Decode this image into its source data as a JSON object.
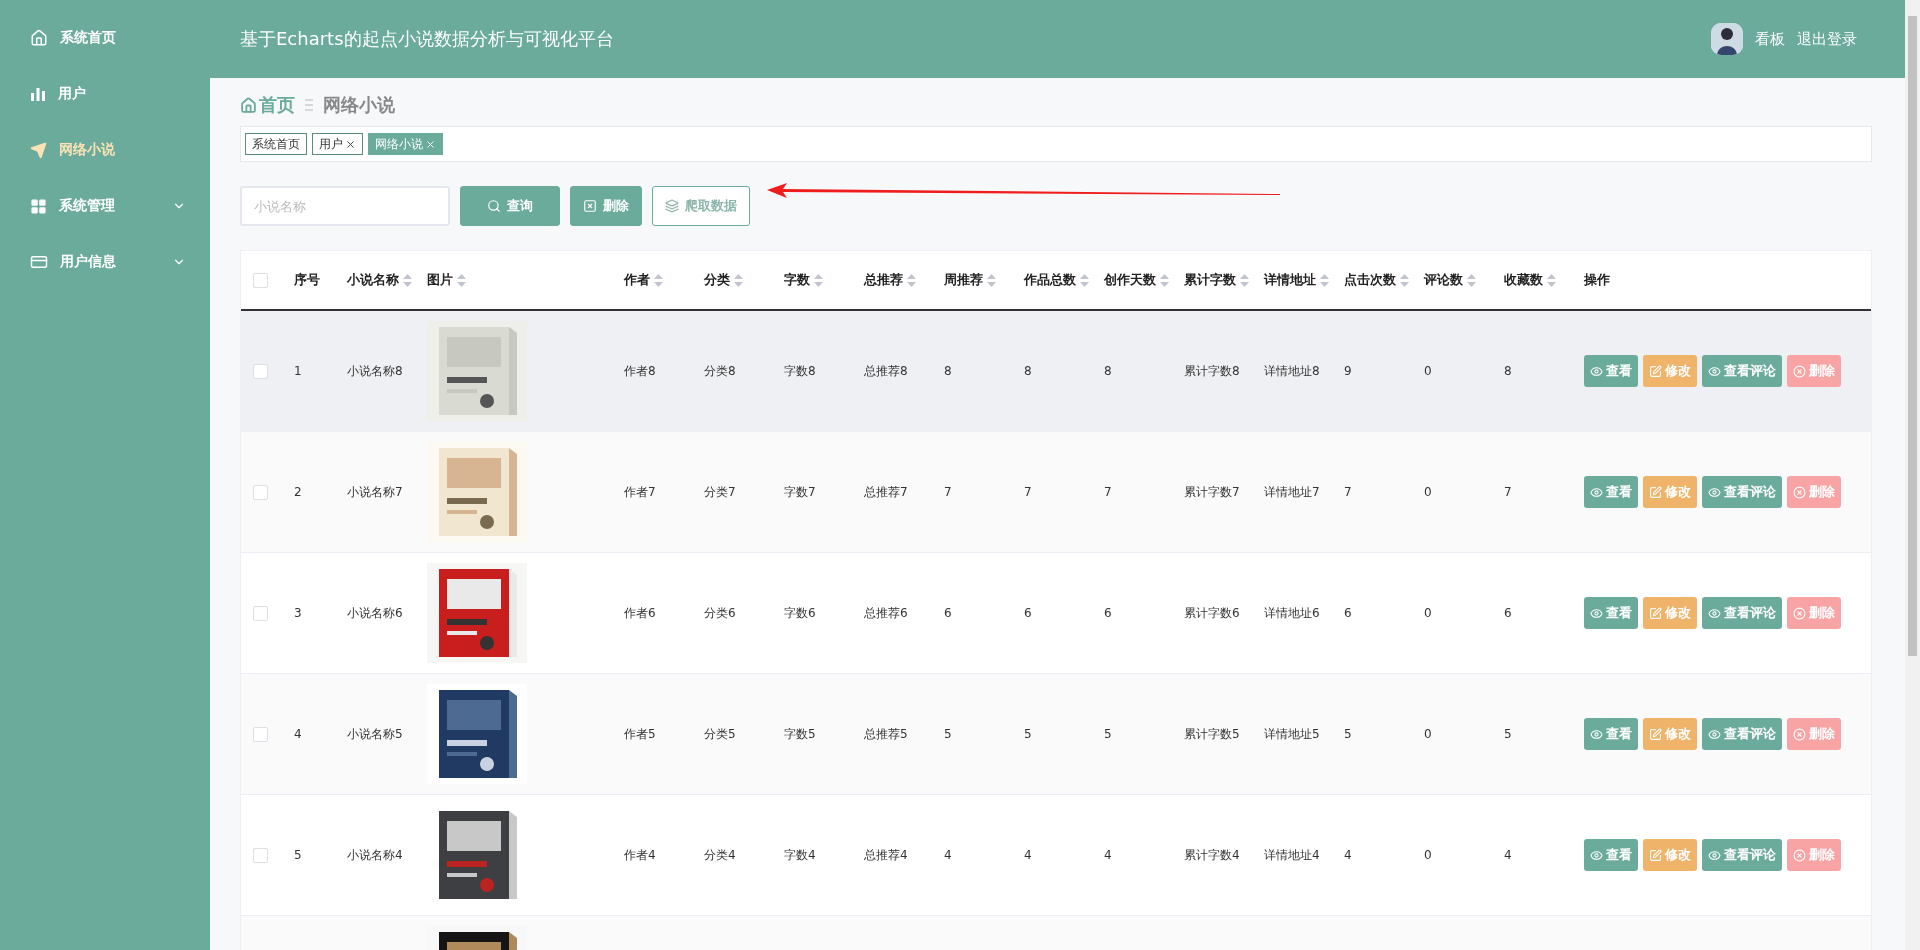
{
  "sidebar": {
    "items": [
      {
        "label": "系统首页",
        "selected": false,
        "has_submenu": false
      },
      {
        "label": "用户",
        "selected": false,
        "has_submenu": false
      },
      {
        "label": "网络小说",
        "selected": true,
        "has_submenu": false
      },
      {
        "label": "系统管理",
        "selected": false,
        "has_submenu": true
      },
      {
        "label": "用户信息",
        "selected": false,
        "has_submenu": true
      }
    ]
  },
  "header": {
    "title": "基于Echarts的起点小说数据分析与可视化平台",
    "user": {
      "name": "看板",
      "logout": "退出登录"
    }
  },
  "breadcrumb": [
    "首页",
    "网络小说"
  ],
  "tabs": [
    {
      "label": "系统首页",
      "closable": false,
      "selected": false
    },
    {
      "label": "用户",
      "closable": true,
      "selected": false
    },
    {
      "label": "网络小说",
      "closable": true,
      "selected": true
    }
  ],
  "toolbar": {
    "search": {
      "placeholder": "小说名称"
    },
    "buttons": [
      {
        "label": "查询",
        "kind": "primary"
      },
      {
        "label": "删除",
        "kind": "primary"
      },
      {
        "label": "爬取数据",
        "kind": "outline"
      }
    ]
  },
  "table": {
    "select_all_checked": false,
    "columns": [
      {
        "label": "序号",
        "sortable": false
      },
      {
        "label": "小说名称",
        "sortable": true
      },
      {
        "label": "图片",
        "sortable": true
      },
      {
        "label": "作者",
        "sortable": true
      },
      {
        "label": "分类",
        "sortable": true
      },
      {
        "label": "字数",
        "sortable": true
      },
      {
        "label": "总推荐",
        "sortable": true
      },
      {
        "label": "周推荐",
        "sortable": true
      },
      {
        "label": "作品总数",
        "sortable": true
      },
      {
        "label": "创作天数",
        "sortable": true
      },
      {
        "label": "累计字数",
        "sortable": true
      },
      {
        "label": "详情地址",
        "sortable": true
      },
      {
        "label": "点击次数",
        "sortable": true
      },
      {
        "label": "评论数",
        "sortable": true
      },
      {
        "label": "收藏数",
        "sortable": true
      },
      {
        "label": "操作",
        "sortable": false
      }
    ],
    "rows": [
      {
        "checked": false,
        "hovered": true,
        "cells": [
          "1",
          "小说名称8",
          {
            "kind": "picture"
          },
          "作者8",
          "分类8",
          "字数8",
          "总推荐8",
          "8",
          "8",
          "8",
          "累计字数8",
          "详情地址8",
          "9",
          "0",
          "8"
        ],
        "actions": [
          {
            "label": "查看",
            "kind": "view"
          },
          {
            "label": "修改",
            "kind": "edit"
          },
          {
            "label": "查看评论",
            "kind": "view"
          },
          {
            "label": "删除",
            "kind": "delete"
          }
        ]
      },
      {
        "checked": false,
        "hovered": false,
        "cells": [
          "2",
          "小说名称7",
          {
            "kind": "picture"
          },
          "作者7",
          "分类7",
          "字数7",
          "总推荐7",
          "7",
          "7",
          "7",
          "累计字数7",
          "详情地址7",
          "7",
          "0",
          "7"
        ],
        "actions": [
          {
            "label": "查看",
            "kind": "view"
          },
          {
            "label": "修改",
            "kind": "edit"
          },
          {
            "label": "查看评论",
            "kind": "view"
          },
          {
            "label": "删除",
            "kind": "delete"
          }
        ]
      },
      {
        "checked": false,
        "hovered": false,
        "cells": [
          "3",
          "小说名称6",
          {
            "kind": "picture"
          },
          "作者6",
          "分类6",
          "字数6",
          "总推荐6",
          "6",
          "6",
          "6",
          "累计字数6",
          "详情地址6",
          "6",
          "0",
          "6"
        ],
        "actions": [
          {
            "label": "查看",
            "kind": "view"
          },
          {
            "label": "修改",
            "kind": "edit"
          },
          {
            "label": "查看评论",
            "kind": "view"
          },
          {
            "label": "删除",
            "kind": "delete"
          }
        ]
      },
      {
        "checked": false,
        "hovered": false,
        "cells": [
          "4",
          "小说名称5",
          {
            "kind": "picture"
          },
          "作者5",
          "分类5",
          "字数5",
          "总推荐5",
          "5",
          "5",
          "5",
          "累计字数5",
          "详情地址5",
          "5",
          "0",
          "5"
        ],
        "actions": [
          {
            "label": "查看",
            "kind": "view"
          },
          {
            "label": "修改",
            "kind": "edit"
          },
          {
            "label": "查看评论",
            "kind": "view"
          },
          {
            "label": "删除",
            "kind": "delete"
          }
        ]
      },
      {
        "checked": false,
        "hovered": false,
        "cells": [
          "5",
          "小说名称4",
          {
            "kind": "picture"
          },
          "作者4",
          "分类4",
          "字数4",
          "总推荐4",
          "4",
          "4",
          "4",
          "累计字数4",
          "详情地址4",
          "4",
          "0",
          "4"
        ],
        "actions": [
          {
            "label": "查看",
            "kind": "view"
          },
          {
            "label": "修改",
            "kind": "edit"
          },
          {
            "label": "查看评论",
            "kind": "view"
          },
          {
            "label": "删除",
            "kind": "delete"
          }
        ]
      },
      {
        "hovered": false,
        "cells": [
          null,
          null,
          {
            "kind": "picture"
          }
        ]
      }
    ]
  }
}
